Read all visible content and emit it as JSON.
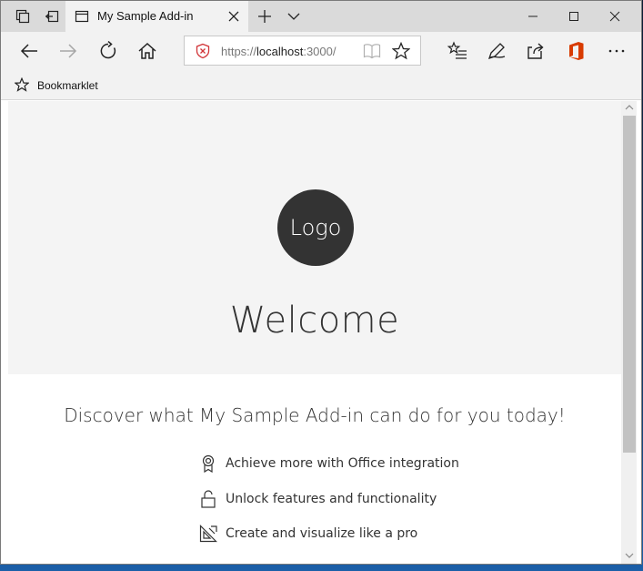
{
  "browser": {
    "tab": {
      "title": "My Sample Add-in"
    },
    "address": {
      "url_prefix": "https://",
      "url_host": "localhost",
      "url_suffix": ":3000/"
    },
    "favorites": {
      "bookmark_label": "Bookmarklet"
    },
    "icons": {
      "tab_actions": "tab-actions-icon",
      "set_aside": "set-aside-tabs-icon",
      "page": "page-icon",
      "close_tab": "close-icon",
      "new_tab": "plus-icon",
      "tab_preview": "chevron-down-icon",
      "minimize": "minimize-icon",
      "maximize": "maximize-icon",
      "close_window": "close-icon",
      "back": "back-arrow-icon",
      "forward": "forward-arrow-icon",
      "refresh": "refresh-icon",
      "home": "home-icon",
      "shield": "shield-warning-icon",
      "reading_view": "book-icon",
      "favorite": "star-icon",
      "favorites_hub": "favorites-list-icon",
      "notes": "pen-icon",
      "share": "share-icon",
      "office": "office-icon",
      "more": "ellipsis-icon"
    }
  },
  "page": {
    "logo_text": "Logo",
    "welcome": "Welcome",
    "tagline": "Discover what My Sample Add-in can do for you today!",
    "features": [
      {
        "icon": "ribbon-icon",
        "label": "Achieve more with Office integration"
      },
      {
        "icon": "unlock-icon",
        "label": "Unlock features and functionality"
      },
      {
        "icon": "design-icon",
        "label": "Create and visualize like a pro"
      }
    ]
  },
  "colors": {
    "hero_bg": "#f4f4f4",
    "logo_bg": "#333333",
    "office_red": "#d83b01",
    "shield_red": "#d13438"
  }
}
